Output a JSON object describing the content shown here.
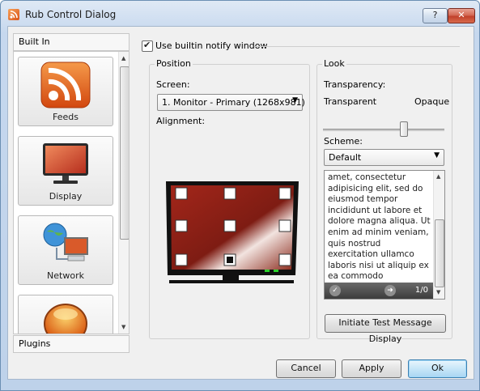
{
  "window": {
    "title": "Rub Control Dialog",
    "help_label": "?",
    "close_label": "✕"
  },
  "sidebar": {
    "header": "Built In",
    "items": [
      {
        "label": "Feeds",
        "icon": "rss-feed-icon"
      },
      {
        "label": "Display",
        "icon": "display-icon"
      },
      {
        "label": "Network",
        "icon": "network-icon"
      },
      {
        "label": "",
        "icon": "orange-orb-icon"
      }
    ],
    "footer": "Plugins"
  },
  "notify_checkbox": {
    "label": "Use builtin notify window",
    "checked": true
  },
  "position": {
    "title": "Position",
    "screen_label": "Screen:",
    "screen_value": "1. Monitor - Primary (1268x981)",
    "alignment_label": "Alignment:",
    "alignment_selected": "bottom-center"
  },
  "look": {
    "title": "Look",
    "transparency_label": "Transparency:",
    "transparent_label": "Transparent",
    "opaque_label": "Opaque",
    "transparency_value": 0.65,
    "scheme_label": "Scheme:",
    "scheme_value": "Default",
    "preview_text": "amet, consectetur adipisicing elit, sed do eiusmod tempor incididunt ut labore et dolore magna aliqua. Ut enim ad minim veniam, quis nostrud exercitation ullamco laboris nisi ut aliquip ex ea commodo consequat.",
    "preview_counter": "1/0",
    "test_button": "Initiate Test Message Display"
  },
  "footer": {
    "cancel": "Cancel",
    "apply": "Apply",
    "ok": "Ok"
  },
  "colors": {
    "rss_orange": "#e8631c",
    "monitor_red": "#a3261a",
    "accent_blue": "#3c7fb1"
  }
}
